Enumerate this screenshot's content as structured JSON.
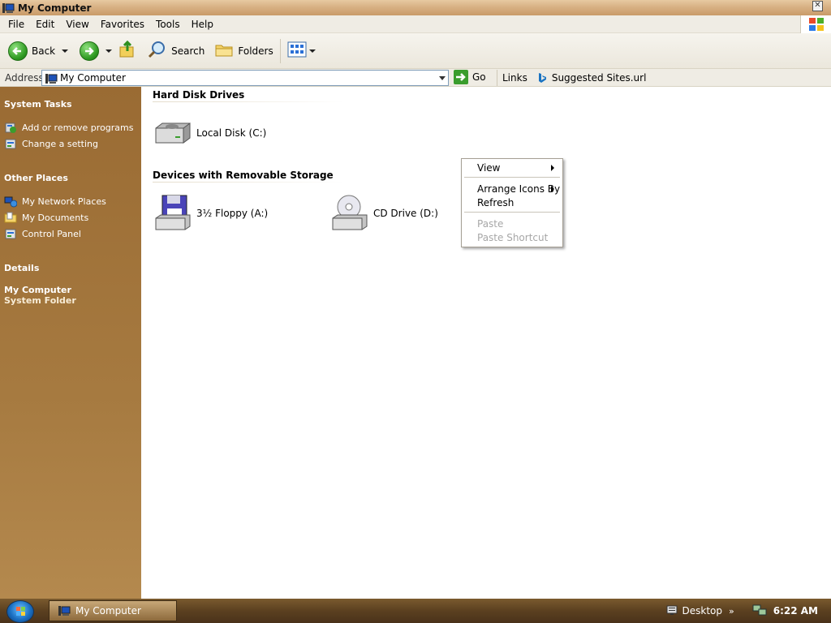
{
  "window": {
    "title": "My Computer"
  },
  "menubar": {
    "items": [
      "File",
      "Edit",
      "View",
      "Favorites",
      "Tools",
      "Help"
    ]
  },
  "toolbar": {
    "back": "Back",
    "search": "Search",
    "folders": "Folders"
  },
  "address": {
    "label": "Address",
    "value": "My Computer",
    "go": "Go",
    "links_label": "Links",
    "link_1": "Suggested Sites.url"
  },
  "taskpane": {
    "system_tasks": {
      "heading": "System Tasks",
      "items": [
        "Add or remove programs",
        "Change a setting"
      ]
    },
    "other_places": {
      "heading": "Other Places",
      "items": [
        "My Network Places",
        "My Documents",
        "Control Panel"
      ]
    },
    "details": {
      "heading": "Details",
      "title": "My Computer",
      "subtitle": "System Folder"
    }
  },
  "content": {
    "groups": [
      {
        "title": "Hard Disk Drives",
        "drives": [
          "Local Disk (C:)"
        ]
      },
      {
        "title": "Devices with Removable Storage",
        "drives": [
          "3½ Floppy (A:)",
          "CD Drive (D:)"
        ]
      }
    ]
  },
  "context_menu": {
    "items": [
      "View",
      "Arrange Icons By",
      "Refresh",
      "Paste",
      "Paste Shortcut"
    ]
  },
  "taskbar": {
    "task": "My Computer",
    "desktop": "Desktop",
    "clock": "6:22 AM"
  }
}
